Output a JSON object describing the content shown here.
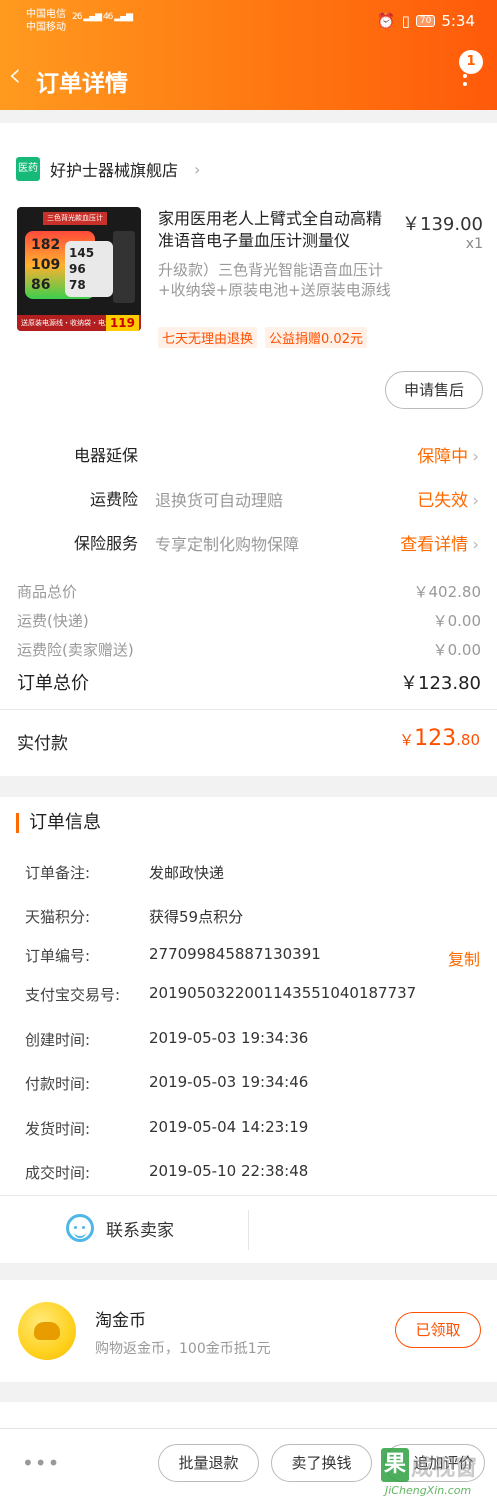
{
  "status_bar": {
    "carrier1": "中国电信",
    "carrier2": "中国移动",
    "net1": "26",
    "net2": "46",
    "battery": "70",
    "time": "5:34"
  },
  "nav": {
    "title": "订单详情",
    "badge": "1"
  },
  "shop": {
    "icon_text": "医药",
    "name": "好护士器械旗舰店"
  },
  "product": {
    "title": "家用医用老人上臂式全自动高精准语音电子量血压计测量仪",
    "price": "￥139.00",
    "qty": "x1",
    "sku": "升级款）三色背光智能语音血压计+收纳袋+原装电池+送原装电源线",
    "tags": [
      "七天无理由退换",
      "公益捐赠0.02元"
    ],
    "thumb": {
      "banner": "三色背光款血压计",
      "reading1": "182",
      "reading2": "109",
      "reading3": "86",
      "r4": "145",
      "r5": "96",
      "r6": "78",
      "footer": "送原装电源线・收纳袋・电池",
      "price": "119"
    },
    "after_sale_button": "申请售后"
  },
  "services": [
    {
      "label": "电器延保",
      "desc": "",
      "status": "保障中"
    },
    {
      "label": "运费险",
      "desc": "退换货可自动理赔",
      "status": "已失效"
    },
    {
      "label": "保险服务",
      "desc": "专享定制化购物保障",
      "status": "查看详情"
    }
  ],
  "prices": [
    {
      "label": "商品总价",
      "value": "￥402.80"
    },
    {
      "label": "运费(快递)",
      "value": "￥0.00"
    },
    {
      "label": "运费险(卖家赠送)",
      "value": "￥0.00"
    }
  ],
  "order_total": {
    "label": "订单总价",
    "value": "￥123.80"
  },
  "paid": {
    "label": "实付款",
    "currency": "￥",
    "main": "123",
    "decimals": ".80"
  },
  "order_info": {
    "title": "订单信息",
    "rows": [
      {
        "k": "订单备注:",
        "v": "发邮政快递"
      },
      {
        "k": "天猫积分:",
        "v": "获得59点积分"
      },
      {
        "k": "订单编号:",
        "v": "277099845887130391"
      },
      {
        "k": "支付宝交易号:",
        "v": "2019050322001143551040187737"
      },
      {
        "k": "创建时间:",
        "v": "2019-05-03 19:34:36"
      },
      {
        "k": "付款时间:",
        "v": "2019-05-03 19:34:46"
      },
      {
        "k": "发货时间:",
        "v": "2019-05-04 14:23:19"
      },
      {
        "k": "成交时间:",
        "v": "2019-05-10 22:38:48"
      }
    ],
    "copy_label": "复制"
  },
  "contact": {
    "label": "联系卖家"
  },
  "coin": {
    "title": "淘金币",
    "subtitle": "购物返金币，100金币抵1元",
    "button": "已领取"
  },
  "bottom": {
    "more": "•••",
    "buttons": [
      "批量退款",
      "卖了换钱",
      "追加评价"
    ]
  },
  "watermark": {
    "box": "果",
    "text": "成视窗",
    "url": "JiChengXin.com"
  },
  "colors": {
    "accent": "#ff6a00",
    "price_red": "#ff5000",
    "header_start": "#ff9a1f",
    "header_end": "#ff5a0a"
  }
}
